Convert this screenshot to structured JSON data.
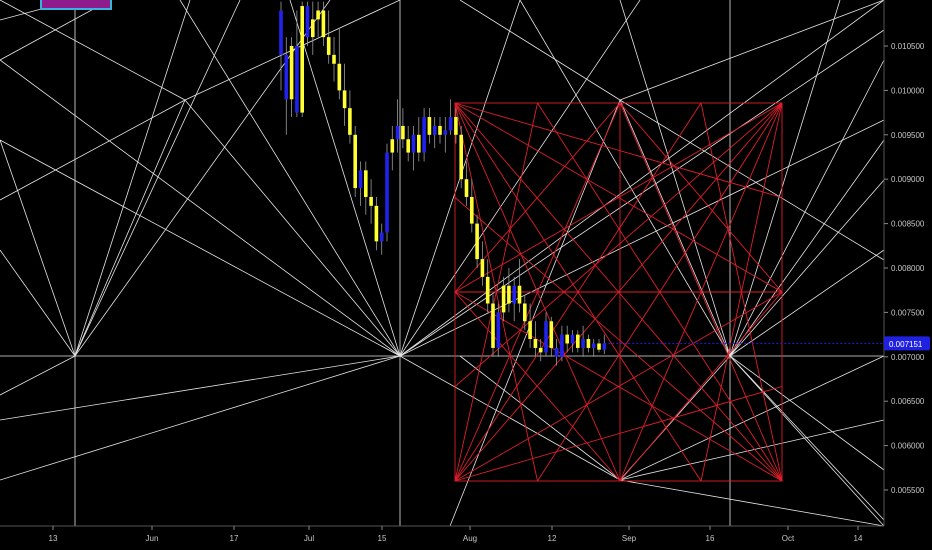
{
  "chart_data": {
    "type": "candlestick",
    "title": "",
    "y_axis": {
      "position": "right",
      "range": [
        0.0053,
        0.0109
      ],
      "ticks": [
        "0.010500",
        "0.010000",
        "0.009500",
        "0.009000",
        "0.008500",
        "0.008000",
        "0.007500",
        "0.007000",
        "0.006500",
        "0.006000",
        "0.005500"
      ]
    },
    "x_axis": {
      "ticks": [
        "13",
        "Jun",
        "17",
        "Jul",
        "15",
        "Aug",
        "12",
        "Sep",
        "16",
        "Oct",
        "14"
      ]
    },
    "current_price": "0.007151",
    "current_price_value": 0.007151,
    "colors": {
      "background": "#000000",
      "up_candle": "#ffff33",
      "down_candle": "#2222ee",
      "overlay_white": "#ffffff",
      "overlay_red": "#dd1f2a",
      "price_tag": "#2020e0",
      "corner_box_fill": "#8e1c8e",
      "corner_box_border": "#36b5d8"
    },
    "overlays": [
      "white geometric angle grid",
      "red square Gann box with diagonals and fans"
    ],
    "grid": false,
    "legend": "none",
    "candles": [
      {
        "o": 0.0109,
        "h": 0.011,
        "l": 0.01,
        "c": 0.0104,
        "up": false
      },
      {
        "o": 0.0104,
        "h": 0.0106,
        "l": 0.0095,
        "c": 0.0099,
        "up": false
      },
      {
        "o": 0.0099,
        "h": 0.0106,
        "l": 0.0097,
        "c": 0.0105,
        "up": true
      },
      {
        "o": 0.0105,
        "h": 0.0109,
        "l": 0.0097,
        "c": 0.00975,
        "up": false
      },
      {
        "o": 0.00975,
        "h": 0.011,
        "l": 0.0097,
        "c": 0.01095,
        "up": true
      },
      {
        "o": 0.01095,
        "h": 0.011,
        "l": 0.0105,
        "c": 0.0106,
        "up": false
      },
      {
        "o": 0.0106,
        "h": 0.011,
        "l": 0.0104,
        "c": 0.0108,
        "up": true
      },
      {
        "o": 0.0108,
        "h": 0.011,
        "l": 0.0106,
        "c": 0.0109,
        "up": true
      },
      {
        "o": 0.0109,
        "h": 0.011,
        "l": 0.0105,
        "c": 0.0106,
        "up": true
      },
      {
        "o": 0.0106,
        "h": 0.0109,
        "l": 0.0103,
        "c": 0.0104,
        "up": true
      },
      {
        "o": 0.0104,
        "h": 0.0106,
        "l": 0.0101,
        "c": 0.0103,
        "up": true
      },
      {
        "o": 0.0103,
        "h": 0.0107,
        "l": 0.0099,
        "c": 0.01,
        "up": true
      },
      {
        "o": 0.01,
        "h": 0.0103,
        "l": 0.0096,
        "c": 0.0098,
        "up": true
      },
      {
        "o": 0.0098,
        "h": 0.01,
        "l": 0.0094,
        "c": 0.0095,
        "up": true
      },
      {
        "o": 0.0095,
        "h": 0.0096,
        "l": 0.0088,
        "c": 0.0089,
        "up": true
      },
      {
        "o": 0.0089,
        "h": 0.0092,
        "l": 0.0087,
        "c": 0.0091,
        "up": false
      },
      {
        "o": 0.0091,
        "h": 0.0092,
        "l": 0.0086,
        "c": 0.0088,
        "up": true
      },
      {
        "o": 0.0088,
        "h": 0.009,
        "l": 0.0085,
        "c": 0.0087,
        "up": true
      },
      {
        "o": 0.0087,
        "h": 0.0088,
        "l": 0.0082,
        "c": 0.0083,
        "up": true
      },
      {
        "o": 0.0083,
        "h": 0.0085,
        "l": 0.00815,
        "c": 0.0084,
        "up": false
      },
      {
        "o": 0.0084,
        "h": 0.0094,
        "l": 0.0083,
        "c": 0.0093,
        "up": false
      },
      {
        "o": 0.0093,
        "h": 0.0096,
        "l": 0.0091,
        "c": 0.00945,
        "up": true
      },
      {
        "o": 0.00945,
        "h": 0.0099,
        "l": 0.0093,
        "c": 0.0096,
        "up": false
      },
      {
        "o": 0.0096,
        "h": 0.0098,
        "l": 0.00935,
        "c": 0.00945,
        "up": true
      },
      {
        "o": 0.00945,
        "h": 0.0096,
        "l": 0.0092,
        "c": 0.0093,
        "up": true
      },
      {
        "o": 0.0093,
        "h": 0.0096,
        "l": 0.0091,
        "c": 0.0095,
        "up": false
      },
      {
        "o": 0.0095,
        "h": 0.0097,
        "l": 0.0092,
        "c": 0.0093,
        "up": true
      },
      {
        "o": 0.0093,
        "h": 0.0098,
        "l": 0.0092,
        "c": 0.0097,
        "up": false
      },
      {
        "o": 0.0097,
        "h": 0.0098,
        "l": 0.0094,
        "c": 0.0095,
        "up": true
      },
      {
        "o": 0.0095,
        "h": 0.0097,
        "l": 0.00935,
        "c": 0.0096,
        "up": false
      },
      {
        "o": 0.0096,
        "h": 0.0097,
        "l": 0.0094,
        "c": 0.0095,
        "up": true
      },
      {
        "o": 0.0095,
        "h": 0.0097,
        "l": 0.0093,
        "c": 0.00955,
        "up": false
      },
      {
        "o": 0.00955,
        "h": 0.0099,
        "l": 0.0095,
        "c": 0.0097,
        "up": false
      },
      {
        "o": 0.0097,
        "h": 0.0098,
        "l": 0.0094,
        "c": 0.0095,
        "up": true
      },
      {
        "o": 0.0095,
        "h": 0.0096,
        "l": 0.0089,
        "c": 0.009,
        "up": true
      },
      {
        "o": 0.009,
        "h": 0.0092,
        "l": 0.0087,
        "c": 0.0088,
        "up": true
      },
      {
        "o": 0.0088,
        "h": 0.009,
        "l": 0.0084,
        "c": 0.0085,
        "up": true
      },
      {
        "o": 0.0085,
        "h": 0.0086,
        "l": 0.008,
        "c": 0.0081,
        "up": true
      },
      {
        "o": 0.0081,
        "h": 0.0083,
        "l": 0.0078,
        "c": 0.0079,
        "up": true
      },
      {
        "o": 0.0079,
        "h": 0.0081,
        "l": 0.0075,
        "c": 0.0076,
        "up": true
      },
      {
        "o": 0.0076,
        "h": 0.0077,
        "l": 0.007,
        "c": 0.0071,
        "up": true
      },
      {
        "o": 0.0071,
        "h": 0.0076,
        "l": 0.007,
        "c": 0.0075,
        "up": false
      },
      {
        "o": 0.0075,
        "h": 0.0079,
        "l": 0.0074,
        "c": 0.0078,
        "up": true
      },
      {
        "o": 0.0078,
        "h": 0.008,
        "l": 0.0075,
        "c": 0.0076,
        "up": true
      },
      {
        "o": 0.0076,
        "h": 0.0079,
        "l": 0.0074,
        "c": 0.0078,
        "up": false
      },
      {
        "o": 0.0078,
        "h": 0.0081,
        "l": 0.0075,
        "c": 0.0076,
        "up": true
      },
      {
        "o": 0.0076,
        "h": 0.0077,
        "l": 0.0073,
        "c": 0.0074,
        "up": true
      },
      {
        "o": 0.0074,
        "h": 0.0076,
        "l": 0.0071,
        "c": 0.0072,
        "up": true
      },
      {
        "o": 0.0072,
        "h": 0.0074,
        "l": 0.007,
        "c": 0.0071,
        "up": true
      },
      {
        "o": 0.0071,
        "h": 0.0072,
        "l": 0.00695,
        "c": 0.00705,
        "up": true
      },
      {
        "o": 0.00705,
        "h": 0.0075,
        "l": 0.007,
        "c": 0.0074,
        "up": false
      },
      {
        "o": 0.0074,
        "h": 0.00745,
        "l": 0.007,
        "c": 0.0071,
        "up": true
      },
      {
        "o": 0.0071,
        "h": 0.0072,
        "l": 0.0069,
        "c": 0.007,
        "up": false
      },
      {
        "o": 0.007,
        "h": 0.00735,
        "l": 0.00695,
        "c": 0.00725,
        "up": false
      },
      {
        "o": 0.00725,
        "h": 0.00735,
        "l": 0.00705,
        "c": 0.00715,
        "up": true
      },
      {
        "o": 0.00715,
        "h": 0.0073,
        "l": 0.00705,
        "c": 0.00725,
        "up": false
      },
      {
        "o": 0.00725,
        "h": 0.0073,
        "l": 0.00705,
        "c": 0.0071,
        "up": true
      },
      {
        "o": 0.0071,
        "h": 0.00735,
        "l": 0.007,
        "c": 0.0072,
        "up": false
      },
      {
        "o": 0.0072,
        "h": 0.00725,
        "l": 0.00705,
        "c": 0.0071,
        "up": true
      },
      {
        "o": 0.0071,
        "h": 0.0072,
        "l": 0.007,
        "c": 0.00715,
        "up": false
      },
      {
        "o": 0.00715,
        "h": 0.0072,
        "l": 0.00705,
        "c": 0.00708,
        "up": true
      },
      {
        "o": 0.00708,
        "h": 0.00725,
        "l": 0.00703,
        "c": 0.00715,
        "up": false
      }
    ]
  }
}
